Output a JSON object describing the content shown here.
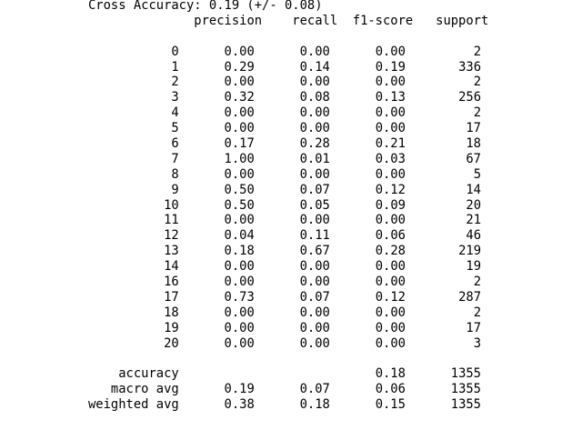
{
  "accuracy_line": "Cross Accuracy: 0.19 (+/- 0.08)",
  "headers": [
    "precision",
    "recall",
    "f1-score",
    "support"
  ],
  "rows": [
    [
      "0",
      "0.00",
      "0.00",
      "0.00",
      "2"
    ],
    [
      "1",
      "0.29",
      "0.14",
      "0.19",
      "336"
    ],
    [
      "2",
      "0.00",
      "0.00",
      "0.00",
      "2"
    ],
    [
      "3",
      "0.32",
      "0.08",
      "0.13",
      "256"
    ],
    [
      "4",
      "0.00",
      "0.00",
      "0.00",
      "2"
    ],
    [
      "5",
      "0.00",
      "0.00",
      "0.00",
      "17"
    ],
    [
      "6",
      "0.17",
      "0.28",
      "0.21",
      "18"
    ],
    [
      "7",
      "1.00",
      "0.01",
      "0.03",
      "67"
    ],
    [
      "8",
      "0.00",
      "0.00",
      "0.00",
      "5"
    ],
    [
      "9",
      "0.50",
      "0.07",
      "0.12",
      "14"
    ],
    [
      "10",
      "0.50",
      "0.05",
      "0.09",
      "20"
    ],
    [
      "11",
      "0.00",
      "0.00",
      "0.00",
      "21"
    ],
    [
      "12",
      "0.04",
      "0.11",
      "0.06",
      "46"
    ],
    [
      "13",
      "0.18",
      "0.67",
      "0.28",
      "219"
    ],
    [
      "14",
      "0.00",
      "0.00",
      "0.00",
      "19"
    ],
    [
      "16",
      "0.00",
      "0.00",
      "0.00",
      "2"
    ],
    [
      "17",
      "0.73",
      "0.07",
      "0.12",
      "287"
    ],
    [
      "18",
      "0.00",
      "0.00",
      "0.00",
      "2"
    ],
    [
      "19",
      "0.00",
      "0.00",
      "0.00",
      "17"
    ],
    [
      "20",
      "0.00",
      "0.00",
      "0.00",
      "3"
    ]
  ],
  "summary": [
    [
      "accuracy",
      "",
      "",
      "0.18",
      "1355"
    ],
    [
      "macro avg",
      "0.19",
      "0.07",
      "0.06",
      "1355"
    ],
    [
      "weighted avg",
      "0.38",
      "0.18",
      "0.15",
      "1355"
    ]
  ]
}
